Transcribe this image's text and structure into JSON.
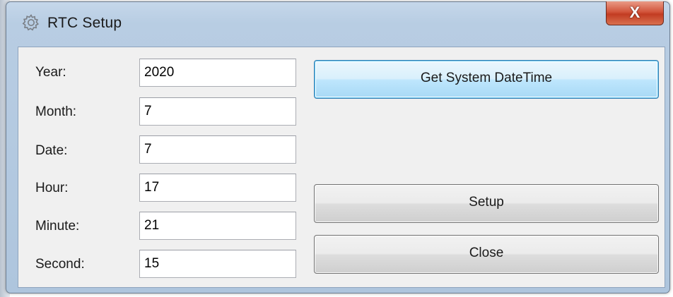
{
  "window": {
    "title": "RTC Setup",
    "close_label": "X",
    "icon": "gear-icon"
  },
  "fields": [
    {
      "label": "Year:",
      "value": "2020"
    },
    {
      "label": "Month:",
      "value": "7"
    },
    {
      "label": "Date:",
      "value": "7"
    },
    {
      "label": "Hour:",
      "value": "17"
    },
    {
      "label": "Minute:",
      "value": "21"
    },
    {
      "label": "Second:",
      "value": "15"
    }
  ],
  "buttons": {
    "get_system_datetime": "Get System DateTime",
    "setup": "Setup",
    "close": "Close"
  },
  "colors": {
    "title_bar": "#b8cde3",
    "client_bg": "#f0f0f0",
    "default_button": "#bee6fd",
    "close_button": "#c23c22"
  }
}
